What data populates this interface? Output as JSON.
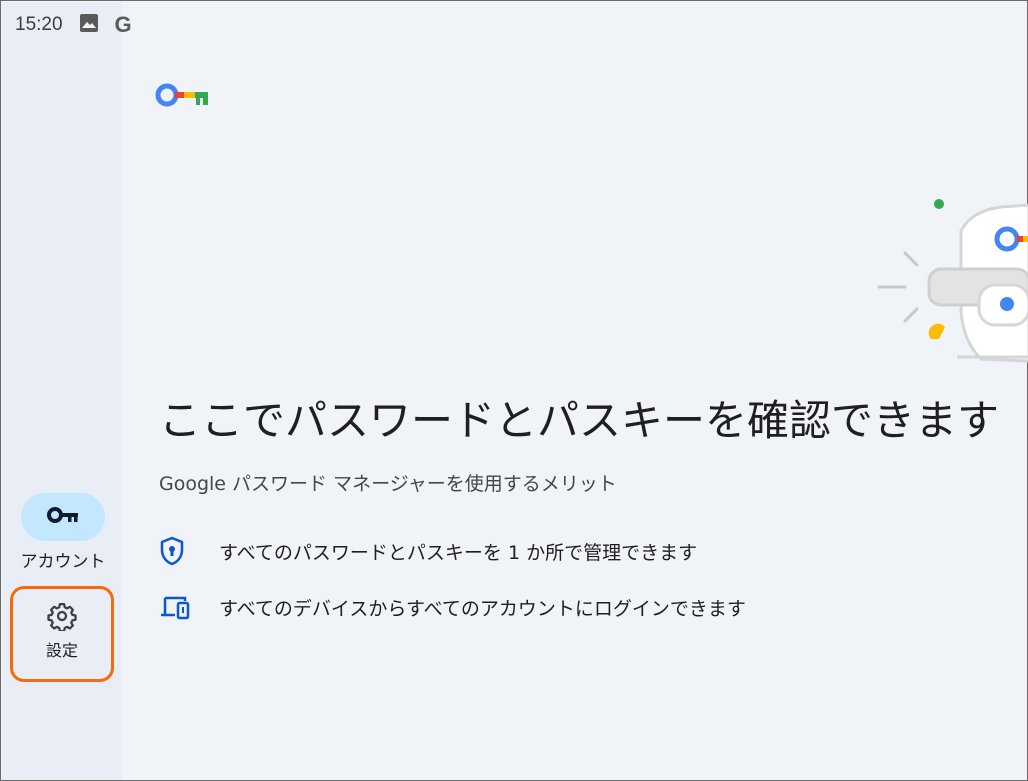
{
  "status_bar": {
    "time": "15:20",
    "icons": [
      "image-icon",
      "google-g-icon"
    ],
    "g_glyph": "G"
  },
  "nav": {
    "account_label": "アカウント",
    "settings_label": "設定"
  },
  "main": {
    "headline": "ここでパスワードとパスキーを確認できます",
    "subtitle": "Google パスワード マネージャーを使用するメリット",
    "benefits": [
      {
        "icon": "shield-lock-icon",
        "text": "すべてのパスワードとパスキーを 1 か所で管理できます"
      },
      {
        "icon": "devices-icon",
        "text": "すべてのデバイスからすべてのアカウントにログインできます"
      }
    ]
  },
  "colors": {
    "background": "#f0f3f8",
    "rail": "#e9edf5",
    "accent_pill": "#c2e7ff",
    "highlight_border": "#f56a0a",
    "google_blue": "#4285f4",
    "google_red": "#ea4335",
    "google_yellow": "#fbbc04",
    "google_green": "#34a853"
  }
}
